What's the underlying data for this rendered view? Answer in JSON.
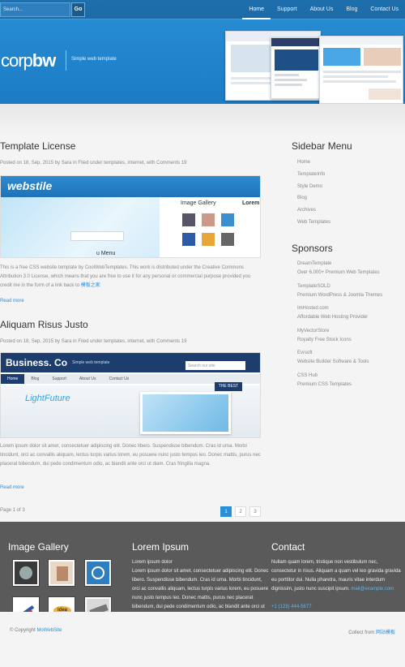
{
  "header": {
    "search_placeholder": "Search...",
    "go_label": "Go",
    "nav": [
      "Home",
      "Support",
      "About Us",
      "Blog",
      "Contact Us"
    ],
    "logo_light": "corp",
    "logo_bold": "bw",
    "slogan": "Simple web template"
  },
  "posts": [
    {
      "title": "Template License",
      "meta": "Posted on 18, Sep, 2015 by Sara in Filed under templates, internet, with Comments 19",
      "img_logo": "webstile",
      "img_heading": "Image Gallery",
      "img_heading2": "Lorem",
      "img_footer": "u Menu",
      "text": "This is a free CSS website template by CoolWebTemplates. This work is distributed under the Creative Commons Attribution 3.0 License, which means that you are free to use it for any personal or commercial purpose provided you credit me in the form of a link back to ",
      "text_link": "模板之家",
      "readmore": "Read more"
    },
    {
      "title": "Aliquam Risus Justo",
      "meta": "Posted on 18, Sep, 2015 by Sara in Filed under templates, internet, with Comments 19",
      "img_logo": "Business. Co",
      "img_logo_sub": "Simple web template",
      "img_search": "Search our site",
      "img_nav": [
        "Home",
        "Blog",
        "Support",
        "About Us",
        "Contact Us"
      ],
      "img_brand": "LightFuture",
      "img_badge": "THE BEST",
      "text": "Lorem ipsum dolor sit amet, consectetuer adipiscing elit. Donec libero. Suspendisse bibendum. Cras id urna. Morbi tincidunt, orci ac convallis aliquam, lectus turpis varius lorem, eu posuere nunc justo tempus leo. Donec mattis, purus nec placerat bibendum, dui pede condimentum odio, ac blandit ante orci ut diam. Cras fringilla magna.",
      "readmore": "Read more"
    }
  ],
  "pager": {
    "label": "Page 1 of 3",
    "pages": [
      "1",
      "2",
      "3"
    ]
  },
  "sidebar": {
    "menu_title": "Sidebar Menu",
    "menu": [
      "Home",
      "TemplateInfo",
      "Style Demo",
      "Blog",
      "Archives",
      "Web Templates"
    ],
    "sponsors_title": "Sponsors",
    "sponsors": [
      {
        "name": "DreamTemplate",
        "desc": "Over 6,000+ Premium Web Templates"
      },
      {
        "name": "TemplateSOLD",
        "desc": "Premium WordPress & Joomla Themes"
      },
      {
        "name": "ImHosted.com",
        "desc": "Affordable Web Hosting Provider"
      },
      {
        "name": "MyVectorStore",
        "desc": "Royalty Free Stock Icons"
      },
      {
        "name": "Evrsoft",
        "desc": "Website Builder Software & Tools"
      },
      {
        "name": "CSS Hub",
        "desc": "Premium CSS Templates"
      }
    ]
  },
  "footer": {
    "gallery_title": "Image Gallery",
    "lorem_title": "Lorem Ipsum",
    "lorem_line1": "Lorem ipsum dolor",
    "lorem_text": "Lorem ipsum dolor sit amet, consectetuer adipiscing elit. Donec libero. Suspendisse bibendum. Cras id urna. Morbi tincidunt, orci ac convallis aliquam, lectus turpis varius lorem, eu posuere nunc justo tempus leo. Donec mattis, purus nec placerat bibendum, dui pede condimentum odio, ac blandit ante orci ut diam.",
    "contact_title": "Contact",
    "contact_text": "Nullam quam lorem, tristique non vestibulum nec, consectetur in risus. Aliquam a quam vel leo gravida gravida eu porttitor dui. Nulla pharetra, mauris vitae interdum dignissim, justo nunc suscipit ipsum. ",
    "contact_email": "mail@example.com",
    "contact_phone": "+1 (123) 444-5677",
    "thumb_idea": "idea",
    "copyright": "© Copyright ",
    "copyright_link": "MoWebSite",
    "collect": "Collect from ",
    "collect_link": "网站模板"
  },
  "colors": {
    "accent": "#2a8fd6",
    "footer_bg": "#5a5a5a"
  }
}
